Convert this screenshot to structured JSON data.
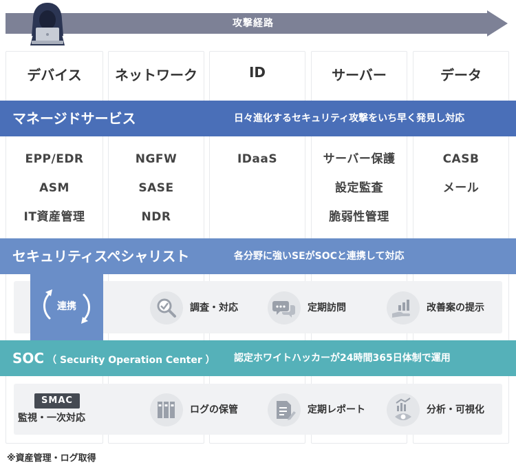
{
  "attack_path": {
    "label": "攻撃経路"
  },
  "columns": [
    {
      "header": "デバイス",
      "items": [
        "EPP/EDR",
        "ASM",
        "IT資産管理"
      ]
    },
    {
      "header": "ネットワーク",
      "items": [
        "NGFW",
        "SASE",
        "NDR"
      ]
    },
    {
      "header": "ID",
      "items": [
        "IDaaS"
      ]
    },
    {
      "header": "サーバー",
      "items": [
        "サーバー保護",
        "設定監査",
        "脆弱性管理"
      ]
    },
    {
      "header": "データ",
      "items": [
        "CASB",
        "メール"
      ]
    }
  ],
  "bands": {
    "managed": {
      "title": "マネージドサービス",
      "desc": "日々進化するセキュリティ攻撃をいち早く発見し対応"
    },
    "specialist": {
      "title": "セキュリティスペシャリスト",
      "desc": "各分野に強いSEがSOCと連携して対応"
    },
    "soc": {
      "title": "SOC",
      "title_sub": "（ Security Operation Center ）",
      "desc": "認定ホワイトハッカーが24時間365日体制で運用"
    }
  },
  "connector": {
    "label": "連携"
  },
  "specialist_features": [
    {
      "label": "調査・対応",
      "icon": "magnifier-check-icon"
    },
    {
      "label": "定期訪問",
      "icon": "speech-bubbles-icon"
    },
    {
      "label": "改善案の提示",
      "icon": "hand-chart-icon"
    }
  ],
  "soc_features": [
    {
      "label": "ログの保管",
      "icon": "binders-icon"
    },
    {
      "label": "定期レポート",
      "icon": "report-pen-icon"
    },
    {
      "label": "分析・可視化",
      "icon": "chart-eye-icon"
    }
  ],
  "smac": {
    "badge": "SMAC",
    "desc": "監視・一次対応"
  },
  "footnote": "※資産管理・ログ取得",
  "colors": {
    "arrow": "#7d8196",
    "managed": "#4a6fb8",
    "specialist": "#6a8ec8",
    "soc": "#55b1b9",
    "panel": "#f1f2f4",
    "icon_bg": "#e4e6e9",
    "badge": "#454a52"
  }
}
